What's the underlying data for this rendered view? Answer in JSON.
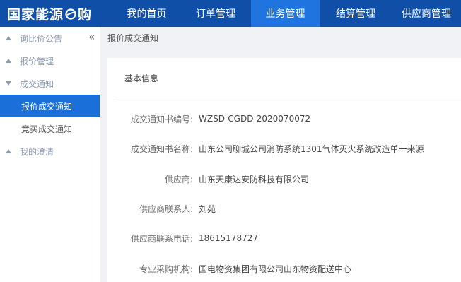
{
  "header": {
    "logo_text_left": "国家能源",
    "logo_text_right": "购",
    "nav": [
      {
        "label": "我的首页",
        "active": false
      },
      {
        "label": "订单管理",
        "active": false
      },
      {
        "label": "业务管理",
        "active": true
      },
      {
        "label": "结算管理",
        "active": false
      },
      {
        "label": "供应商管理",
        "active": false
      }
    ]
  },
  "sidebar": {
    "groups": [
      {
        "label": "询比价公告",
        "expanded": false
      },
      {
        "label": "报价管理",
        "expanded": false
      },
      {
        "label": "成交通知",
        "expanded": true,
        "items": [
          {
            "label": "报价成交通知",
            "active": true
          },
          {
            "label": "竞买成交通知",
            "active": false
          }
        ]
      },
      {
        "label": "我的澄清",
        "expanded": false
      }
    ]
  },
  "breadcrumb": "报价成交通知",
  "card": {
    "title": "基本信息",
    "fields": [
      {
        "label": "成交通知书编号:",
        "value": "WZSD-CGDD-2020070072"
      },
      {
        "label": "成交通知书名称:",
        "value": "山东公司聊城公司消防系统1301气体灭火系统改造单一来源"
      },
      {
        "label": "供应商:",
        "value": "山东天康达安防科技有限公司"
      },
      {
        "label": "供应商联系人:",
        "value": "刘苑"
      },
      {
        "label": "供应商联系电话:",
        "value": "18615178727"
      },
      {
        "label": "专业采购机构:",
        "value": "国电物资集团有限公司山东物资配送中心"
      }
    ]
  },
  "colors": {
    "topbar": "#0f4fa8",
    "nav_active": "#1f74e0",
    "menu_active": "#1a6fd8"
  }
}
